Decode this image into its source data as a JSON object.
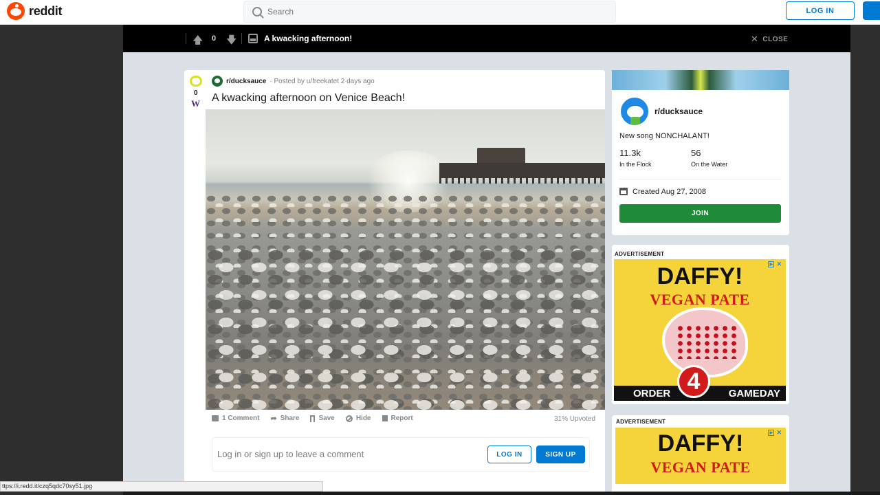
{
  "nav": {
    "logo_text": "reddit",
    "search_placeholder": "Search",
    "login_label": "LOG IN"
  },
  "post_bar": {
    "score": "0",
    "title": "A kwacking afternoon!",
    "close_label": "CLOSE"
  },
  "post": {
    "vote_score": "0",
    "subreddit": "r/ducksauce",
    "posted_by": "· Posted by u/freekatet 2 days ago",
    "title": "A kwacking afternoon on Venice Beach!",
    "actions": {
      "comments": "1 Comment",
      "share": "Share",
      "save": "Save",
      "hide": "Hide",
      "report": "Report"
    },
    "upvoted": "31% Upvoted",
    "comment_prompt": "Log in or sign up to leave a comment",
    "comment_login": "LOG IN",
    "comment_signup": "SIGN UP"
  },
  "sidebar": {
    "name": "r/ducksauce",
    "description": "New song NONCHALANT!",
    "members": "11.3k",
    "members_label": "In the Flock",
    "online": "56",
    "online_label": "On the Water",
    "created": "Created Aug 27, 2008",
    "join_label": "JOIN"
  },
  "ads": [
    {
      "label": "ADVERTISEMENT",
      "headline": "DAFFY!",
      "subheadline": "VEGAN PATE",
      "bottom_left": "ORDER",
      "badge": "4",
      "bottom_right": "GAMEDAY"
    },
    {
      "label": "ADVERTISEMENT",
      "headline": "DAFFY!",
      "subheadline": "VEGAN PATE"
    }
  ],
  "status_bar": {
    "url": "ttps://i.redd.it/czq5qdc70sy51.jpg"
  },
  "colors": {
    "brand": "#ff4500",
    "link_blue": "#0079d3",
    "join_green": "#1d8b38",
    "ad_yellow": "#f4d43a",
    "ad_red": "#d11a1a"
  }
}
